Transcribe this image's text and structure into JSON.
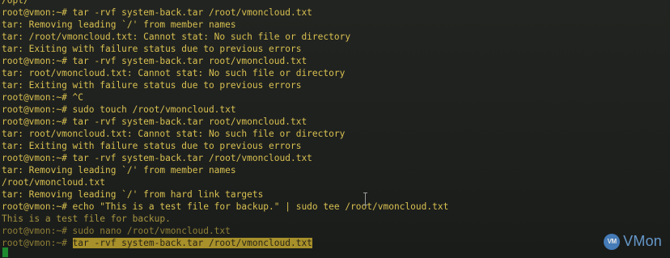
{
  "terminal": {
    "lines": [
      "/opt/",
      "root@vmon:~# tar -rvf system-back.tar /root/vmoncloud.txt",
      "tar: Removing leading `/' from member names",
      "tar: /root/vmoncloud.txt: Cannot stat: No such file or directory",
      "tar: Exiting with failure status due to previous errors",
      "root@vmon:~# tar -rvf system-back.tar root/vmoncloud.txt",
      "tar: root/vmoncloud.txt: Cannot stat: No such file or directory",
      "tar: Exiting with failure status due to previous errors",
      "root@vmon:~# ^C",
      "root@vmon:~# sudo touch /root/vmoncloud.txt",
      "root@vmon:~# tar -rvf system-back.tar root/vmoncloud.txt",
      "tar: root/vmoncloud.txt: Cannot stat: No such file or directory",
      "tar: Exiting with failure status due to previous errors",
      "root@vmon:~# tar -rvf system-back.tar /root/vmoncloud.txt",
      "tar: Removing leading `/' from member names",
      "/root/vmoncloud.txt",
      "tar: Removing leading `/' from hard link targets",
      "root@vmon:~# echo \"This is a test file for backup.\" | sudo tee /root/vmoncloud.txt",
      "This is a test file for backup.",
      "root@vmon:~# sudo nano /root/vmoncloud.txt"
    ],
    "last_prompt": "root@vmon:~# ",
    "selected_command": "tar -rvf system-back.tar /root/vmoncloud.txt"
  },
  "watermark": {
    "badge": "VM",
    "text": "VMon"
  },
  "colors": {
    "background": "#1d1f1d",
    "text": "#d8c050",
    "selection": "#a8902a",
    "cursor": "#1f8a2e",
    "watermark": "#6fa6de"
  }
}
